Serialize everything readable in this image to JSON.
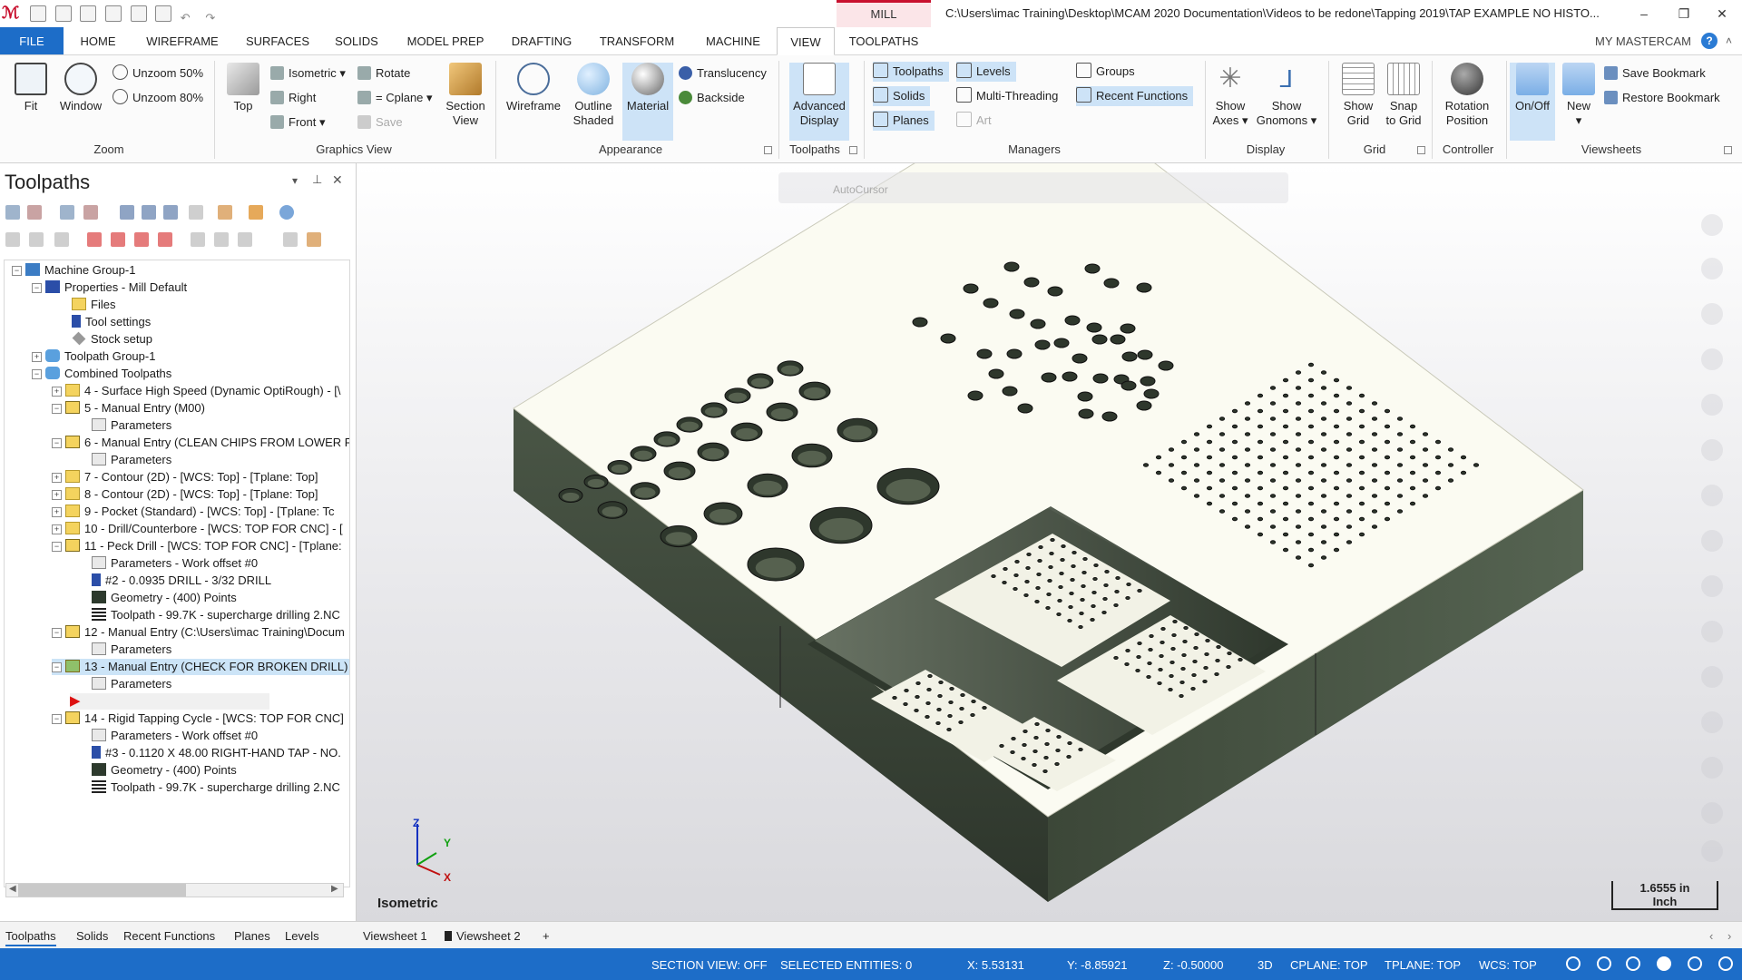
{
  "app": {
    "title": "C:\\Users\\imac Training\\Desktop\\MCAM 2020 Documentation\\Videos to be redone\\Tapping 2019\\TAP EXAMPLE NO HISTO...",
    "context_tab": "MILL",
    "my_mastercam": "MY MASTERCAM",
    "window_controls": [
      "–",
      "❐",
      "✕"
    ]
  },
  "tabs": [
    "FILE",
    "HOME",
    "WIREFRAME",
    "SURFACES",
    "SOLIDS",
    "MODEL PREP",
    "DRAFTING",
    "TRANSFORM",
    "MACHINE",
    "VIEW",
    "TOOLPATHS"
  ],
  "ribbon": {
    "zoom": {
      "label": "Zoom",
      "fit": "Fit",
      "window": "Window",
      "unzoom50": "Unzoom 50%",
      "unzoom80": "Unzoom 80%"
    },
    "graphics_view": {
      "label": "Graphics View",
      "top": "Top",
      "isometric": "Isometric",
      "right": "Right",
      "front": "Front",
      "rotate": "Rotate",
      "cplane": "= Cplane",
      "save": "Save",
      "section_view_1": "Section",
      "section_view_2": "View"
    },
    "appearance": {
      "label": "Appearance",
      "wireframe": "Wireframe",
      "outline_1": "Outline",
      "outline_2": "Shaded",
      "material": "Material",
      "translucency": "Translucency",
      "backside": "Backside"
    },
    "toolpaths": {
      "label": "Toolpaths",
      "advanced_1": "Advanced",
      "advanced_2": "Display"
    },
    "managers": {
      "label": "Managers",
      "toolpaths": "Toolpaths",
      "solids": "Solids",
      "planes": "Planes",
      "levels": "Levels",
      "multithreading": "Multi-Threading",
      "art": "Art",
      "groups": "Groups",
      "recent": "Recent Functions"
    },
    "display": {
      "label": "Display",
      "show_axes_1": "Show",
      "show_axes_2": "Axes",
      "show_gnomons_1": "Show",
      "show_gnomons_2": "Gnomons"
    },
    "grid": {
      "label": "Grid",
      "show_grid_1": "Show",
      "show_grid_2": "Grid",
      "snap_1": "Snap",
      "snap_2": "to Grid"
    },
    "controller": {
      "label": "Controller",
      "rotation_1": "Rotation",
      "rotation_2": "Position"
    },
    "viewsheets": {
      "label": "Viewsheets",
      "onoff": "On/Off",
      "new": "New",
      "save_bookmark": "Save Bookmark",
      "restore_bookmark": "Restore Bookmark"
    }
  },
  "left_panel": {
    "title": "Toolpaths",
    "tree": [
      "Machine Group-1",
      "Properties - Mill Default",
      "Files",
      "Tool settings",
      "Stock setup",
      "Toolpath Group-1",
      "Combined Toolpaths",
      "4 - Surface High Speed (Dynamic OptiRough) - [\\",
      "5 - Manual Entry (M00)",
      "Parameters",
      "6 - Manual Entry (CLEAN CHIPS FROM LOWER R",
      "Parameters",
      "7 - Contour (2D) - [WCS: Top] - [Tplane: Top]",
      "8 - Contour (2D) - [WCS: Top] - [Tplane: Top]",
      "9 - Pocket (Standard) - [WCS: Top] - [Tplane: Tc",
      "10 - Drill/Counterbore - [WCS: TOP FOR CNC] - [",
      "11 - Peck Drill - [WCS: TOP FOR CNC] - [Tplane:",
      "Parameters - Work offset #0",
      "#2 - 0.0935 DRILL - 3/32 DRILL",
      "Geometry - (400) Points",
      "Toolpath - 99.7K - supercharge drilling 2.NC",
      "12 - Manual Entry (C:\\Users\\imac Training\\Docum",
      "Parameters",
      "13 - Manual Entry (CHECK FOR BROKEN DRILL)",
      "Parameters",
      "",
      "14 - Rigid Tapping Cycle - [WCS: TOP FOR CNC]",
      "Parameters - Work offset #0",
      "#3 - 0.1120 X 48.00 RIGHT-HAND TAP - NO.",
      "Geometry - (400) Points",
      "Toolpath - 99.7K - supercharge drilling 2.NC"
    ]
  },
  "bottom_tabs": [
    "Toolpaths",
    "Solids",
    "Recent Functions",
    "Planes",
    "Levels"
  ],
  "viewsheets": [
    "Viewsheet 1",
    "Viewsheet 2",
    "+"
  ],
  "viewport": {
    "floating_toolbar": "AutoCursor",
    "view_label": "Isometric",
    "scale_value": "1.6555 in",
    "scale_unit": "Inch",
    "axis_labels": {
      "x": "X",
      "y": "Y",
      "z": "Z"
    }
  },
  "status": {
    "section_view": "SECTION VIEW: OFF",
    "selected": "SELECTED ENTITIES: 0",
    "x": "X:   5.53131",
    "y": "Y:   -8.85921",
    "z": "Z:   -0.50000",
    "mode": "3D",
    "cplane": "CPLANE: TOP",
    "tplane": "TPLANE: TOP",
    "wcs": "WCS: TOP"
  },
  "colors": {
    "accent": "#1d6dc8",
    "mill": "#c8102e",
    "part_side": "#3a4536",
    "part_top": "#fdfdf4"
  }
}
